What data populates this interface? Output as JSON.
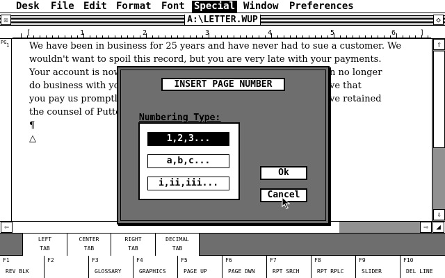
{
  "menubar": {
    "items": [
      {
        "label": "Desk"
      },
      {
        "label": "File"
      },
      {
        "label": "Edit"
      },
      {
        "label": "Format"
      },
      {
        "label": "Font"
      },
      {
        "label": "Special",
        "active": true
      },
      {
        "label": "Window"
      },
      {
        "label": "Preferences"
      }
    ]
  },
  "window": {
    "title": "A:\\LETTER.WUP",
    "close_icon": "close-icon",
    "fuller_icon": "fuller-icon",
    "page_marker": "PG",
    "page_number": "1"
  },
  "ruler": {
    "numbers": [
      "1",
      "2",
      "3",
      "4",
      "5",
      "6"
    ],
    "margin_marks": [
      "[",
      "]"
    ]
  },
  "document": {
    "lines": [
      "We have been in business for 25 years and have never had to sue a customer.  We",
      "wouldn't want to spoil this record, but you are very late with your payments.",
      "Your account is now",
      "do business with you",
      "you pay us promptly",
      "the counsel of Putter",
      "¶",
      "△"
    ],
    "line_tails": [
      "",
      "",
      "n no longer",
      "ve that",
      "ve retained",
      "",
      "",
      ""
    ]
  },
  "dialog": {
    "title": "INSERT PAGE NUMBER",
    "numbering_label": "Numbering Type:",
    "options": [
      {
        "label": "1,2,3...",
        "selected": true
      },
      {
        "label": "a,b,c...",
        "selected": false
      },
      {
        "label": "i,ii,iii...",
        "selected": false
      }
    ],
    "ok_label": "Ok",
    "cancel_label": "Cancel"
  },
  "tabs": [
    {
      "line1": "LEFT",
      "line2": "TAB"
    },
    {
      "line1": "CENTER",
      "line2": "TAB"
    },
    {
      "line1": "RIGHT",
      "line2": "TAB"
    },
    {
      "line1": "DECIMAL",
      "line2": "TAB"
    }
  ],
  "fkeys": [
    {
      "key": "F1",
      "label": "REV BLK"
    },
    {
      "key": "F2",
      "label": ""
    },
    {
      "key": "F3",
      "label": "GLOSSARY"
    },
    {
      "key": "F4",
      "label": "GRAPHICS"
    },
    {
      "key": "F5",
      "label": "PAGE UP"
    },
    {
      "key": "F6",
      "label": "PAGE DWN"
    },
    {
      "key": "F7",
      "label": "RPT SRCH"
    },
    {
      "key": "F8",
      "label": "RPT RPLC"
    },
    {
      "key": "F9",
      "label": "SLIDER"
    },
    {
      "key": "F10",
      "label": "DEL LINE"
    }
  ],
  "scroll": {
    "up_icon": "arrow-up-icon",
    "down_icon": "arrow-down-icon",
    "left_icon": "arrow-left-icon",
    "right_icon": "arrow-right-icon",
    "size_icon": "resize-icon"
  }
}
